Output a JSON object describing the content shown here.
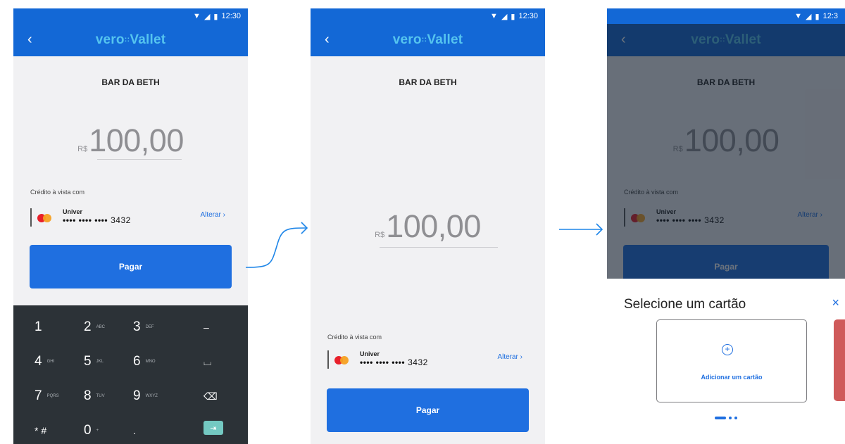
{
  "status_bar": {
    "time_full": "12:30",
    "time_cut": "12:3"
  },
  "app_bar": {
    "back": "‹",
    "logo_left": "vero",
    "logo_dots": "::",
    "logo_right": "Vallet"
  },
  "merchant": "BAR DA BETH",
  "amount": {
    "currency": "R$",
    "value": "100,00"
  },
  "payment": {
    "credit_label_1": "Crédito à vista com",
    "credit_label_2": "Crédito à vista com",
    "card_name": "Univer",
    "card_mask": "•••• •••• ••••",
    "card_last4": "3432",
    "change_label": "Alterar ›",
    "pay_label": "Pagar"
  },
  "keypad": {
    "keys": [
      {
        "main": "1",
        "sub": ""
      },
      {
        "main": "2",
        "sub": "ABC"
      },
      {
        "main": "3",
        "sub": "DEF"
      },
      {
        "main": "–",
        "sub": ""
      },
      {
        "main": "4",
        "sub": "GHI"
      },
      {
        "main": "5",
        "sub": "JKL"
      },
      {
        "main": "6",
        "sub": "MNO"
      },
      {
        "main": "⌴",
        "sub": ""
      },
      {
        "main": "7",
        "sub": "PQRS"
      },
      {
        "main": "8",
        "sub": "TUV"
      },
      {
        "main": "9",
        "sub": "WXYZ"
      },
      {
        "main": "⌫",
        "sub": ""
      },
      {
        "main": "* #",
        "sub": ""
      },
      {
        "main": "0",
        "sub": "+"
      },
      {
        "main": ".",
        "sub": ""
      },
      {
        "main": "⇥",
        "sub": ""
      }
    ]
  },
  "sheet": {
    "title": "Selecione um cartão",
    "close": "×",
    "add_card_icon": "⊕",
    "add_card_label": "Adicionar um cartão"
  },
  "colors": {
    "primary": "#1368d6",
    "accent": "#1f6fe0",
    "keypad": "#2c3237",
    "go_key": "#74c9c2"
  },
  "icons": [
    "wifi-icon",
    "signal-icon",
    "battery-icon",
    "back-chevron-icon",
    "mastercard-icon",
    "plus-circle-icon",
    "close-icon",
    "flow-arrow-icon"
  ]
}
